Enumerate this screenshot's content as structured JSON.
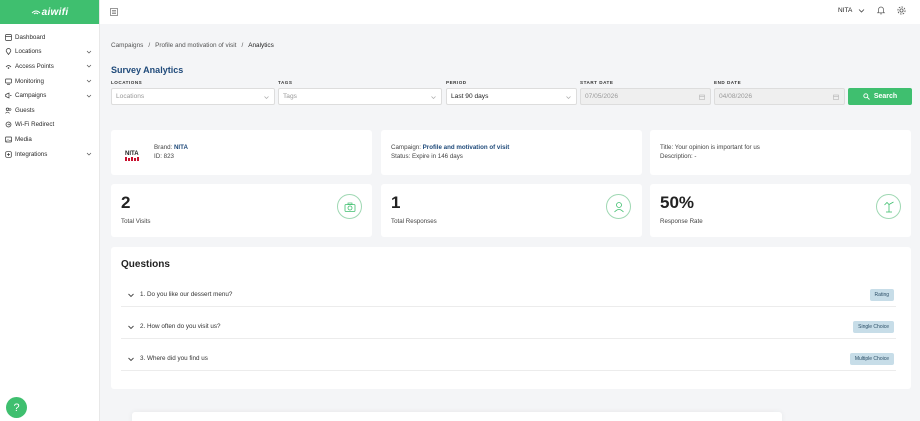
{
  "app": {
    "logo": "aiwifi",
    "accent": "#3fbf6f"
  },
  "sidebar": {
    "items": [
      {
        "label": "Dashboard",
        "icon": "dashboard-icon",
        "expandable": false
      },
      {
        "label": "Locations",
        "icon": "location-pin-icon",
        "expandable": true
      },
      {
        "label": "Access Points",
        "icon": "access-point-icon",
        "expandable": true
      },
      {
        "label": "Monitoring",
        "icon": "monitor-icon",
        "expandable": true
      },
      {
        "label": "Campaigns",
        "icon": "megaphone-icon",
        "expandable": true
      },
      {
        "label": "Guests",
        "icon": "guests-icon",
        "expandable": false
      },
      {
        "label": "Wi-Fi Redirect",
        "icon": "redirect-icon",
        "expandable": false
      },
      {
        "label": "Media",
        "icon": "media-icon",
        "expandable": false
      },
      {
        "label": "Integrations",
        "icon": "integrations-icon",
        "expandable": true
      }
    ]
  },
  "topbar": {
    "user": "NITA"
  },
  "breadcrumb": {
    "items": [
      "Campaigns",
      "Profile and motivation of visit",
      "Analytics"
    ],
    "separator": "/"
  },
  "page": {
    "title": "Survey Analytics"
  },
  "filters": {
    "locations": {
      "label": "LOCATIONS",
      "placeholder": "Locations"
    },
    "tags": {
      "label": "TAGS",
      "placeholder": "Tags"
    },
    "period": {
      "label": "PERIOD",
      "value": "Last 90 days"
    },
    "start_date": {
      "label": "START DATE",
      "value": "07/05/2026"
    },
    "end_date": {
      "label": "END DATE",
      "value": "04/08/2026"
    },
    "search_label": "Search"
  },
  "brand_card": {
    "brand_prefix": "Brand:",
    "brand": "NITA",
    "id_text": "ID: 823",
    "logo_text": "NITA"
  },
  "campaign_card": {
    "prefix": "Campaign:",
    "name": "Profile and motivation of visit",
    "status": "Status: Expire in 146 days"
  },
  "title_card": {
    "title": "Title: Your opinion is important for us",
    "description": "Description: -"
  },
  "stats": [
    {
      "value": "2",
      "label": "Total Visits",
      "icon": "camera-icon"
    },
    {
      "value": "1",
      "label": "Total Responses",
      "icon": "user-icon"
    },
    {
      "value": "50%",
      "label": "Response Rate",
      "icon": "chart-up-icon"
    }
  ],
  "questions": {
    "title": "Questions",
    "items": [
      {
        "text": "1. Do you like our dessert menu?",
        "type": "Rating"
      },
      {
        "text": "2. How often do you visit us?",
        "type": "Single Choice"
      },
      {
        "text": "3. Where did you find us",
        "type": "Multiple Choice"
      }
    ]
  },
  "help": {
    "label": "?"
  }
}
